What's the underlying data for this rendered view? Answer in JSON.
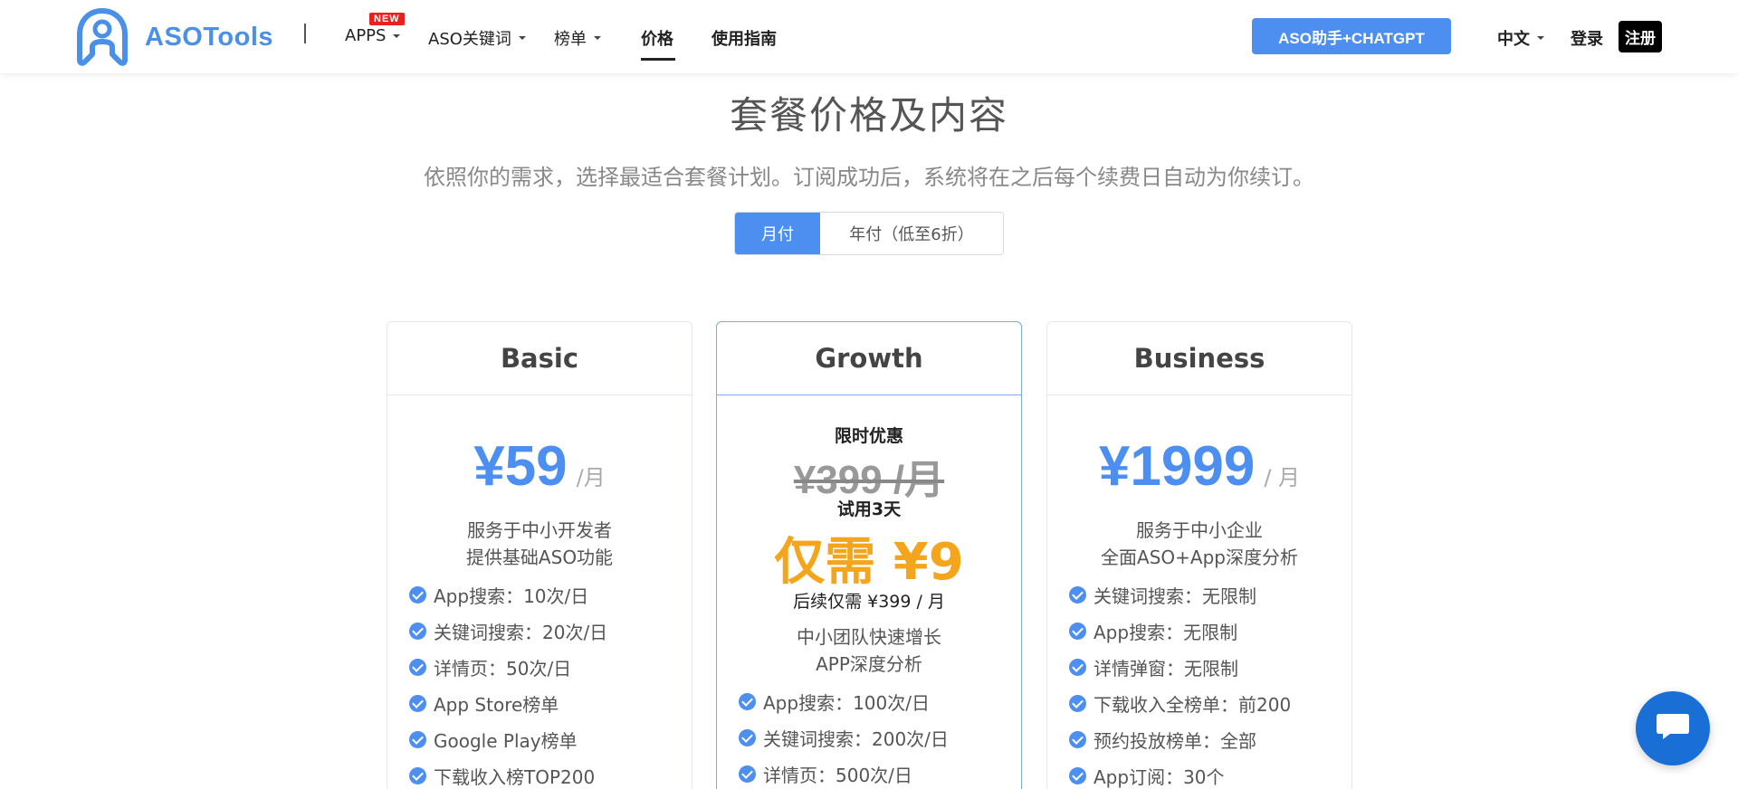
{
  "header": {
    "logo_text": "ASOTools",
    "nav": {
      "apps": "APPS",
      "new_badge": "NEW",
      "keywords": "ASO关键词",
      "charts": "榜单",
      "pricing": "价格",
      "guide": "使用指南"
    },
    "gpt_button": "ASO助手+CHATGPT",
    "language": "中文",
    "login": "登录",
    "register": "注册"
  },
  "main": {
    "title": "套餐价格及内容",
    "subtitle": "依照你的需求，选择最适合套餐计划。订阅成功后，系统将在之后每个续费日自动为你续订。",
    "billing_toggle": {
      "monthly": "月付",
      "yearly": "年付（低至6折）",
      "selected": "月付"
    }
  },
  "plans": {
    "basic": {
      "name": "Basic",
      "price": "¥59",
      "unit": "/月",
      "desc_line1": "服务于中小开发者",
      "desc_line2": "提供基础ASO功能",
      "features": [
        "App搜索：10次/日",
        "关键词搜索：20次/日",
        "详情页：50次/日",
        "App Store榜单",
        "Google Play榜单",
        "下载收入榜TOP200"
      ]
    },
    "growth": {
      "name": "Growth",
      "promo_label": "限时优惠",
      "old_price": "¥399 /月",
      "trial_label": "试用3天",
      "now_price": "仅需 ¥9",
      "after_price": "后续仅需 ¥399 / 月",
      "desc_line1": "中小团队快速增长",
      "desc_line2": "APP深度分析",
      "features": [
        "App搜索：100次/日",
        "关键词搜索：200次/日",
        "详情页：500次/日"
      ]
    },
    "business": {
      "name": "Business",
      "price": "¥1999",
      "unit": "/ 月",
      "desc_line1": "服务于中小企业",
      "desc_line2": "全面ASO+App深度分析",
      "features": [
        "关键词搜索：无限制",
        "App搜索：无限制",
        "详情弹窗：无限制",
        "下载收入全榜单：前200",
        "预约投放榜单：全部",
        "App订阅：30个"
      ]
    }
  },
  "colors": {
    "accent": "#4d8ff0",
    "promo": "#f5a51b",
    "badge": "#e8201e",
    "chat": "#1a6fd6"
  },
  "icons": {
    "logo": "robot-logo-icon",
    "check": "check-circle-icon",
    "chat": "chat-bubble-icon",
    "dropdown": "caret-down-icon"
  }
}
